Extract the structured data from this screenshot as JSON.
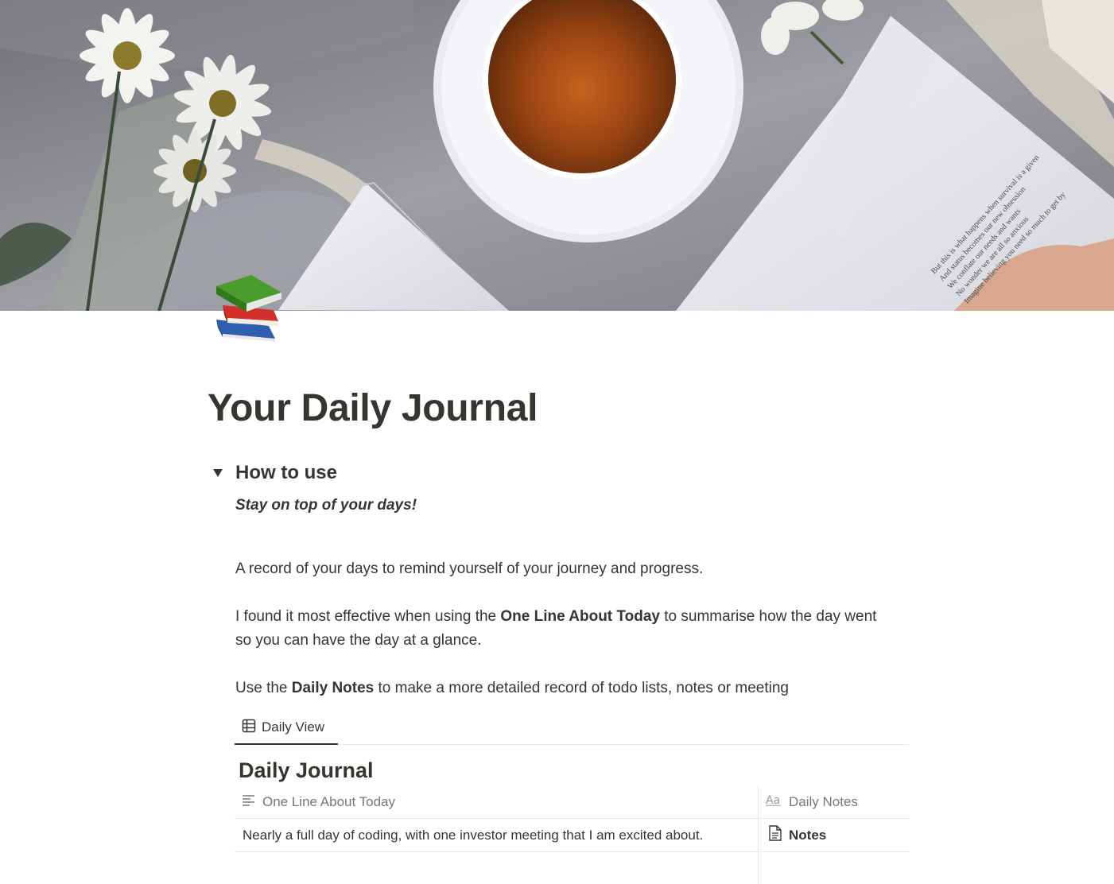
{
  "cover": {
    "book_text": [
      "But this is what happens when survival is a given",
      "And status becomes our new obsession",
      "We conflate our needs and wants",
      "No wonder we are all so anxious",
      "Imagine believing you need so much to get by"
    ]
  },
  "page": {
    "icon": "books-icon",
    "title": "Your Daily Journal"
  },
  "toggle": {
    "title": "How to use",
    "expanded": true,
    "tagline": "Stay on top of your days!",
    "para1": "A record of your days to remind yourself of your journey and progress.",
    "para2_pre": "I found it most effective when using the ",
    "para2_bold": "One Line About Today",
    "para2_post": " to summarise how the day went so you can have the day at a glance.",
    "para3_pre": "Use the ",
    "para3_bold": "Daily Notes",
    "para3_post": " to make a more detailed record of todo lists, notes or meeting"
  },
  "view": {
    "tab_label": "Daily View",
    "tab_icon": "table-icon"
  },
  "database": {
    "title": "Daily Journal",
    "columns": [
      {
        "label": "One Line About Today",
        "icon": "text-lines-icon"
      },
      {
        "label": "Daily Notes",
        "icon": "title-aa-icon"
      }
    ],
    "rows": [
      {
        "one_line": "Nearly a full day of coding, with one investor meeting that I am excited about.",
        "notes": "Notes",
        "notes_icon": "page-icon"
      }
    ]
  },
  "colors": {
    "text": "#37352f",
    "muted": "#787774",
    "divider": "#e9e9e7"
  }
}
